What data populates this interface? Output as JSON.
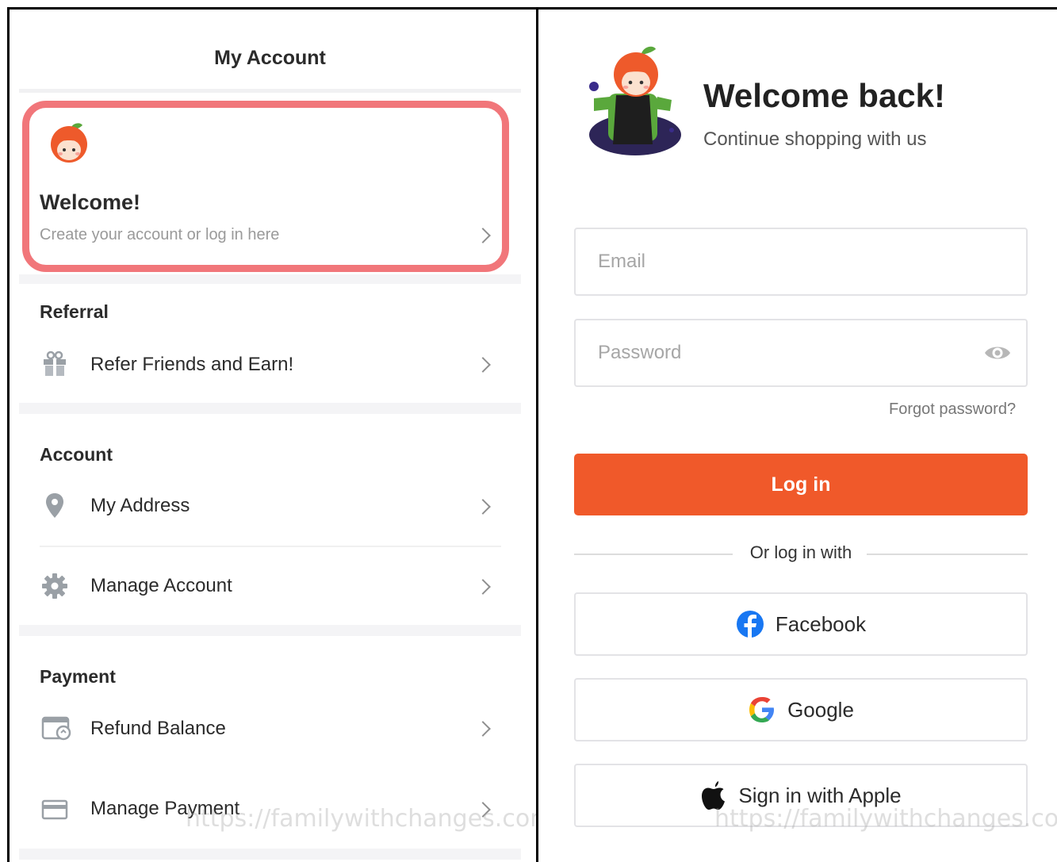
{
  "account": {
    "title": "My Account",
    "welcome": {
      "title": "Welcome!",
      "subtitle": "Create your account or log in here"
    },
    "sections": [
      {
        "title": "Referral",
        "items": [
          {
            "label": "Refer Friends and Earn!",
            "icon": "gift-icon"
          }
        ]
      },
      {
        "title": "Account",
        "items": [
          {
            "label": "My Address",
            "icon": "location-pin-icon"
          },
          {
            "label": "Manage Account",
            "icon": "gear-icon"
          }
        ]
      },
      {
        "title": "Payment",
        "items": [
          {
            "label": "Refund Balance",
            "icon": "refund-wallet-icon"
          },
          {
            "label": "Manage Payment",
            "icon": "credit-card-icon"
          }
        ]
      }
    ],
    "highlight_color": "#f1767a"
  },
  "login": {
    "title": "Welcome back!",
    "subtitle": "Continue shopping with us",
    "email_placeholder": "Email",
    "password_placeholder": "Password",
    "forgot": "Forgot password?",
    "login_button": "Log in",
    "or_text": "Or log in with",
    "facebook": "Facebook",
    "google": "Google",
    "apple": "Sign in with Apple",
    "accent_color": "#f0592a"
  },
  "watermark": "https://familywithchanges.com"
}
